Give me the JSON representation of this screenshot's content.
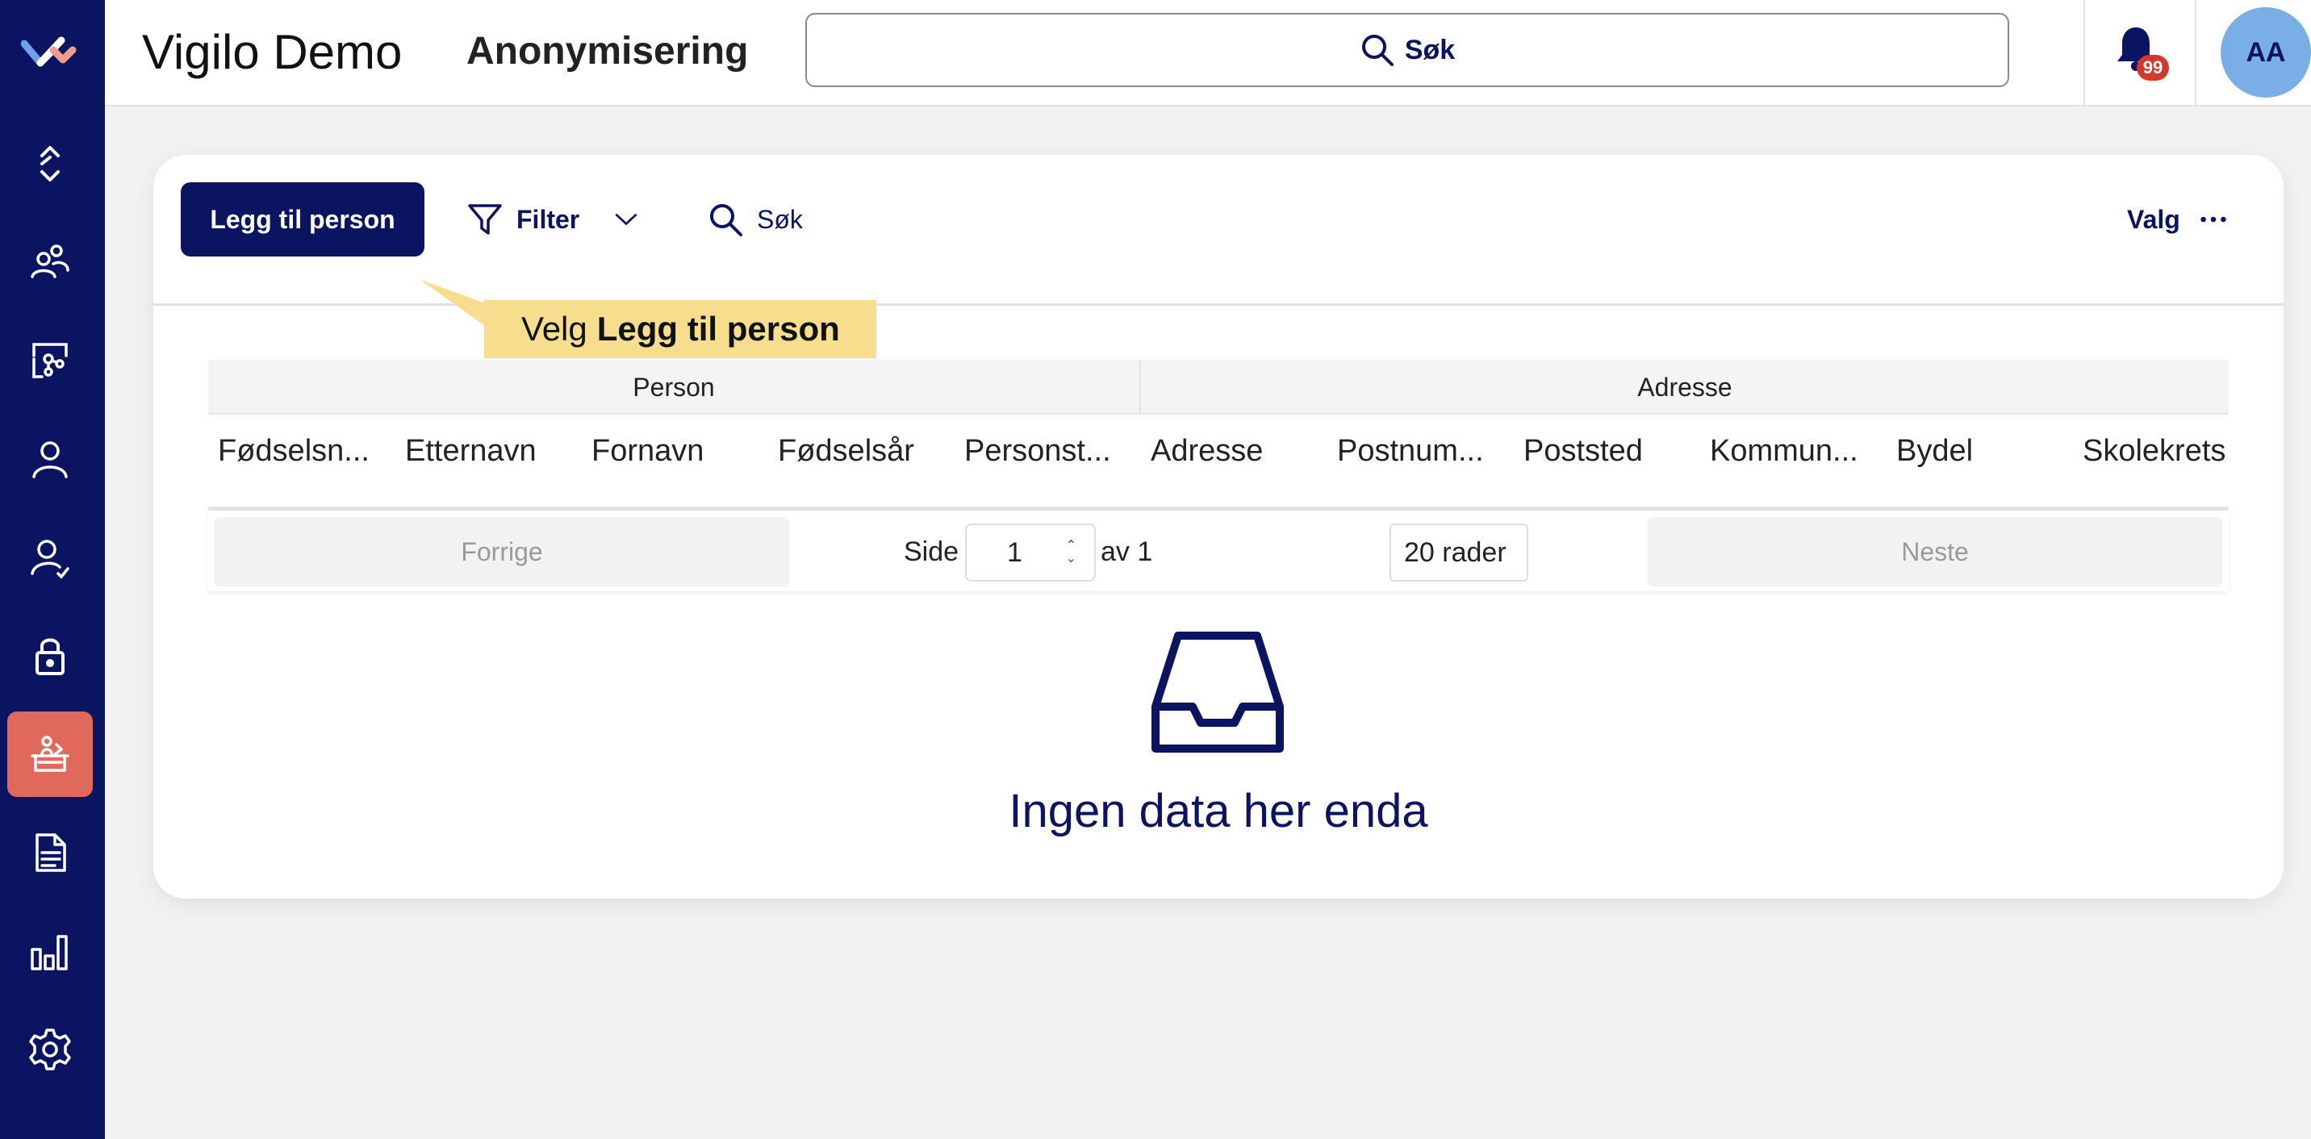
{
  "sidebar": {
    "logo": "vigilo-logo",
    "items": [
      {
        "icon": "expand-collapse-icon"
      },
      {
        "icon": "people-icon"
      },
      {
        "icon": "network-search-icon"
      },
      {
        "icon": "person-icon"
      },
      {
        "icon": "person-check-icon"
      },
      {
        "icon": "lock-icon"
      },
      {
        "icon": "anonymize-icon",
        "active": true
      },
      {
        "icon": "document-icon"
      },
      {
        "icon": "bar-chart-icon"
      },
      {
        "icon": "gear-icon"
      }
    ],
    "bg_color": "#0b1461",
    "active_color": "#e0695c"
  },
  "header": {
    "app_title": "Vigilo Demo",
    "module_title": "Anonymisering",
    "search_label": "Søk",
    "notification_count": "99",
    "avatar_initials": "AA"
  },
  "toolbar": {
    "add_person_label": "Legg til person",
    "filter_label": "Filter",
    "search_label": "Søk",
    "options_label": "Valg"
  },
  "tooltip": {
    "prefix": "Velg",
    "target": "Legg til person"
  },
  "table": {
    "groups": [
      "Person",
      "Adresse"
    ],
    "columns": [
      "Fødselsn...",
      "Etternavn",
      "Fornavn",
      "Fødselsår",
      "Personst...",
      "Adresse",
      "Postnum...",
      "Poststed",
      "Kommun...",
      "Bydel",
      "Skolekrets"
    ]
  },
  "pager": {
    "prev_label": "Forrige",
    "page_label": "Side",
    "page_value": "1",
    "of_label": "av 1",
    "rows_label": "20 rader",
    "next_label": "Neste"
  },
  "empty_state": {
    "icon": "inbox-icon",
    "text": "Ingen data her enda"
  }
}
